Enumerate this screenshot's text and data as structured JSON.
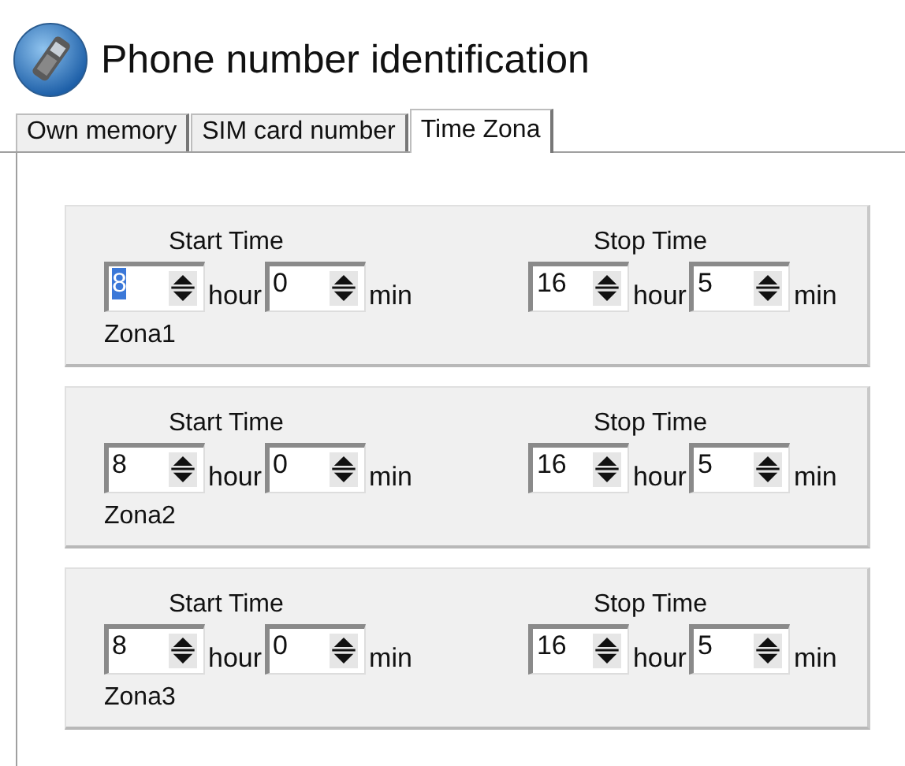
{
  "header": {
    "title": "Phone number identification"
  },
  "tabs": [
    {
      "label": "Own memory",
      "selected": false
    },
    {
      "label": "SIM card number",
      "selected": false
    },
    {
      "label": "Time Zona",
      "selected": true
    }
  ],
  "zones": [
    {
      "label": "Zona1",
      "groups": [
        {
          "title": "Start Time",
          "fields": [
            {
              "value": "8",
              "unit": "hour",
              "selected": true
            },
            {
              "value": "0",
              "unit": "min",
              "selected": false
            }
          ]
        },
        {
          "title": "Stop Time",
          "fields": [
            {
              "value": "16",
              "unit": "hour",
              "selected": false
            },
            {
              "value": "5",
              "unit": "min",
              "selected": false
            }
          ]
        }
      ]
    },
    {
      "label": "Zona2",
      "groups": [
        {
          "title": "Start Time",
          "fields": [
            {
              "value": "8",
              "unit": "hour",
              "selected": false
            },
            {
              "value": "0",
              "unit": "min",
              "selected": false
            }
          ]
        },
        {
          "title": "Stop Time",
          "fields": [
            {
              "value": "16",
              "unit": "hour",
              "selected": false
            },
            {
              "value": "5",
              "unit": "min",
              "selected": false
            }
          ]
        }
      ]
    },
    {
      "label": "Zona3",
      "groups": [
        {
          "title": "Start Time",
          "fields": [
            {
              "value": "8",
              "unit": "hour",
              "selected": false
            },
            {
              "value": "0",
              "unit": "min",
              "selected": false
            }
          ]
        },
        {
          "title": "Stop Time",
          "fields": [
            {
              "value": "16",
              "unit": "hour",
              "selected": false
            },
            {
              "value": "5",
              "unit": "min",
              "selected": false
            }
          ]
        }
      ]
    }
  ]
}
